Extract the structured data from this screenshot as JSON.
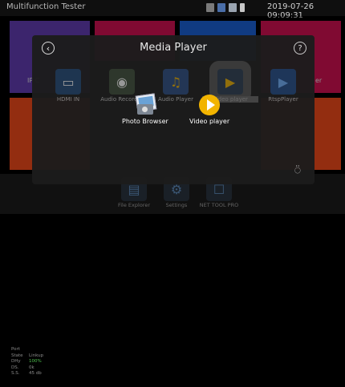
{
  "app_title": "Multifunction Tester",
  "datetime": "2019-07-26 09:09:31",
  "status_icons": [
    "battery-icon",
    "usb-icon",
    "sd-card-icon",
    "network-icon"
  ],
  "colors": {
    "tile_purple": "#5c3aa8",
    "tile_pink": "#c5104e",
    "tile_blue": "#1a5bc8",
    "tile_orange": "#e2451a",
    "accent_yellow": "#f2b400"
  },
  "dialog": {
    "title": "Media Player"
  },
  "apps": [
    {
      "label": "HDMI IN",
      "icon": "hdmi-icon"
    },
    {
      "label": "Audio Recorder",
      "icon": "recorder-icon"
    },
    {
      "label": "Audio Player",
      "icon": "music-note-icon"
    },
    {
      "label": "Video player",
      "icon": "video-play-icon"
    },
    {
      "label": "RtspPlayer",
      "icon": "rtsp-play-icon"
    }
  ],
  "popup": [
    {
      "label": "Photo Browser",
      "icon": "photo-browser-icon"
    },
    {
      "label": "Video player",
      "icon": "video-player-icon"
    }
  ],
  "bg_labels": {
    "left": "IP C",
    "right": "er"
  },
  "dock": [
    {
      "label": "File Explorer"
    },
    {
      "label": "Settings"
    },
    {
      "label": "NET TOOL PRO"
    }
  ],
  "info": {
    "rows": [
      [
        "Port",
        ""
      ],
      [
        "State",
        "Linkup"
      ],
      [
        "DHy",
        "100%"
      ],
      [
        "DS.",
        "0k"
      ],
      [
        "S.S.",
        "45 db"
      ]
    ]
  }
}
